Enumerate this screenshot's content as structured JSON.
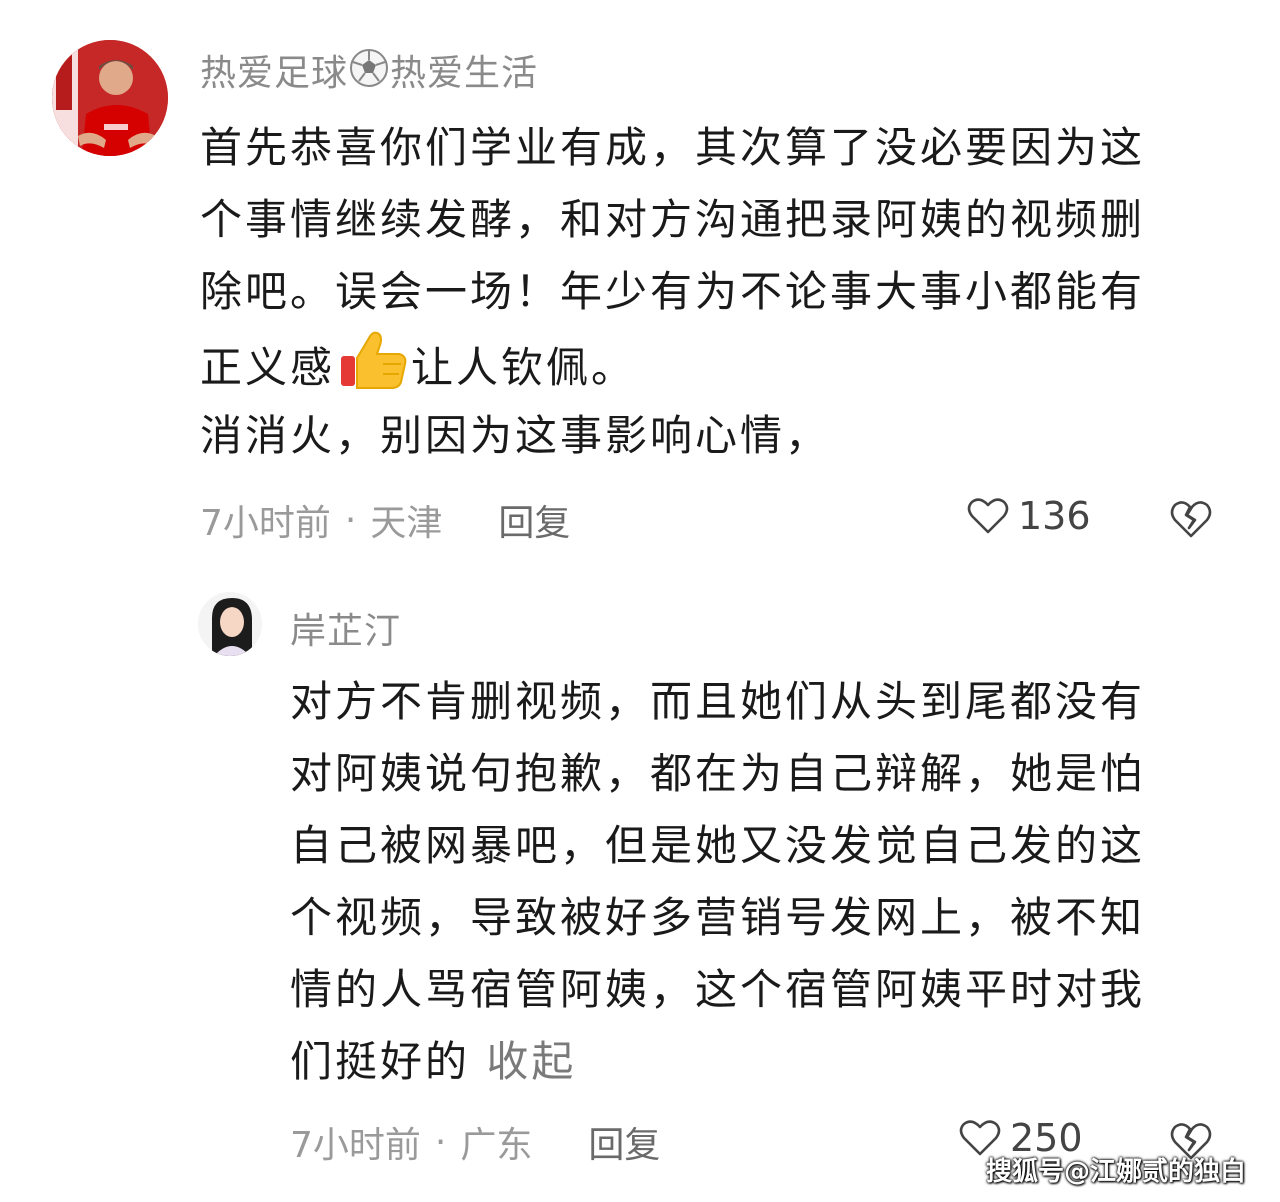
{
  "comments": [
    {
      "username": "热爱足球",
      "username_suffix": "热爱生活",
      "username_icon": "soccer-ball-icon",
      "avatar_icon": "user-avatar-football-player",
      "lines": [
        "首先恭喜你们学业有成，其次算了没必要因为这",
        "个事情继续发酵，和对方沟通把录阿姨的视频删",
        "除吧。误会一场！年少有为不论事大事小都能有"
      ],
      "line4_before": "正义感",
      "line4_icon": "thumbs-up-icon",
      "line4_after": "让人钦佩。",
      "line5": "消消火，别因为这事影响心情，",
      "time": "7小时前",
      "location": "天津",
      "reply_label": "回复",
      "likes": "136"
    },
    {
      "username": "岸芷汀",
      "avatar_icon": "user-avatar-girl",
      "lines": [
        "对方不肯删视频，而且她们从头到尾都没有",
        "对阿姨说句抱歉，都在为自己辩解，她是怕",
        "自己被网暴吧，但是她又没发觉自己发的这",
        "个视频，导致被好多营销号发网上，被不知",
        "情的人骂宿管阿姨，这个宿管阿姨平时对我"
      ],
      "last_line": "们挺好的",
      "collapse_label": "收起",
      "time": "7小时前",
      "location": "广东",
      "reply_label": "回复",
      "likes": "250"
    }
  ],
  "separator": "·",
  "watermark": "搜狐号@江娜贰的独白",
  "colors": {
    "meta_text": "#9a9a9a",
    "username": "#8a8a8a",
    "body_text": "#1a1a1a"
  }
}
